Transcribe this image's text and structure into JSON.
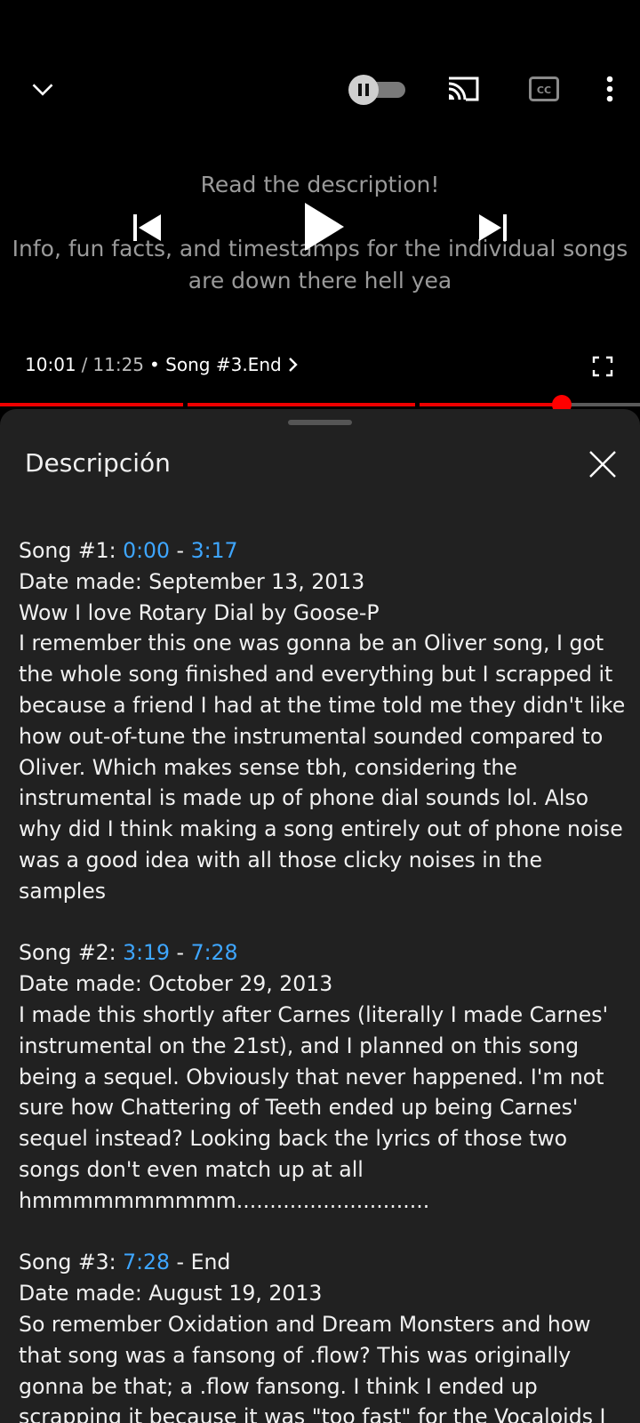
{
  "player": {
    "caption_line1": "Read the description!",
    "caption_line2": "Info, fun facts, and timestamps for the individual songs",
    "caption_line3": "are down there hell yea",
    "current_time": "10:01",
    "separator": "/",
    "duration": "11:25",
    "chapter": "• Song #3.End",
    "progress_fraction": 0.878,
    "autoplay_state": "paused",
    "icons": [
      "chevron-down-icon",
      "pause-icon",
      "cast-icon",
      "cc-icon",
      "more-icon",
      "skip-previous-icon",
      "play-icon",
      "skip-next-icon",
      "fullscreen-icon",
      "chevron-right-icon"
    ]
  },
  "sheet": {
    "title": "Descripción",
    "songs": [
      {
        "label": "Song #1: ",
        "ts_start": "0:00",
        "dash": " - ",
        "ts_end": "3:17",
        "end_text": "",
        "date": "Date made: September 13, 2013",
        "body": [
          "Wow I love Rotary Dial by Goose-P",
          "I remember this one was gonna be an Oliver song, I got the whole song finished and everything but I scrapped it because a friend I had at the time told me they didn't like how out-of-tune the instrumental sounded compared to Oliver. Which makes sense tbh, considering the instrumental is made up of phone dial sounds lol. Also why did I think making a song entirely out of phone noise was a good idea with all those clicky noises in the samples"
        ]
      },
      {
        "label": "Song #2: ",
        "ts_start": "3:19",
        "dash": " - ",
        "ts_end": "7:28",
        "end_text": "",
        "date": "Date made: October 29, 2013",
        "body": [
          "I made this shortly after Carnes (literally I made Carnes' instrumental on the 21st), and I planned on this song being a sequel. Obviously that never happened. I'm not sure how Chattering of Teeth ended up being Carnes' sequel instead? Looking back the lyrics of those two songs don't even match up at all hmmmmmmmmmm............................."
        ]
      },
      {
        "label": "Song #3: ",
        "ts_start": "7:28",
        "dash": " - End",
        "ts_end": "",
        "end_text": "",
        "date": "Date made: August 19, 2013",
        "body": [
          "So remember Oxidation and Dream Monsters and how that song was a fansong of .flow? This was originally gonna be that; a .flow fansong. I think I ended up scrapping it because it was \"too fast\" for the Vocaloids I"
        ]
      }
    ]
  },
  "colors": {
    "accent": "#ff0000",
    "link": "#3ea6ff",
    "sheet_bg": "#212121"
  }
}
